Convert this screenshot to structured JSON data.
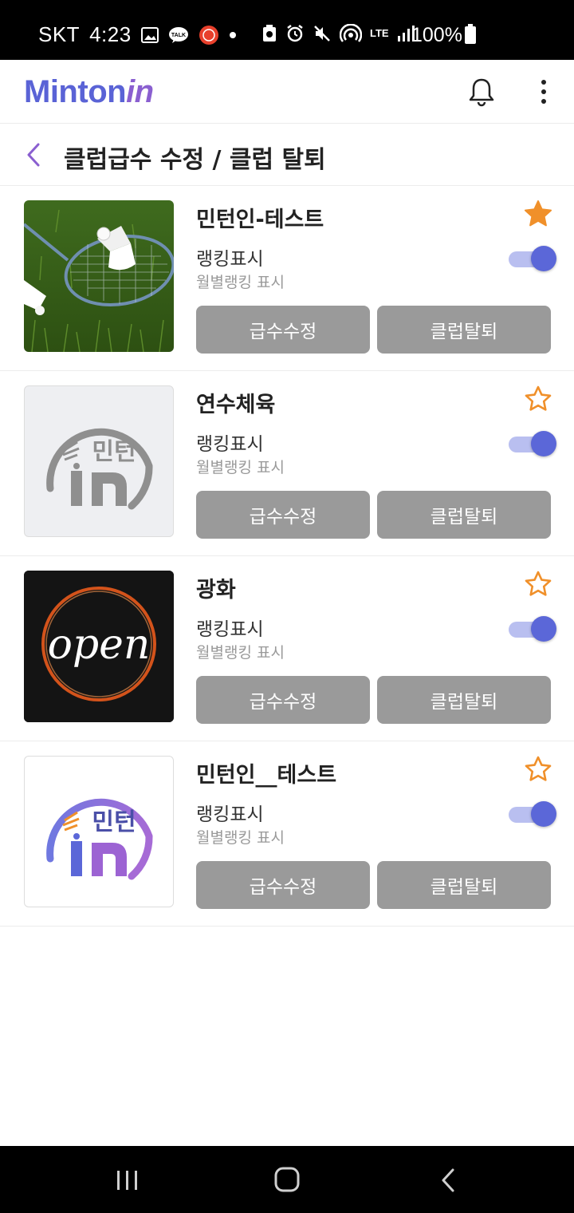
{
  "status_bar": {
    "carrier": "SKT",
    "time": "4:23",
    "battery_percent": "100%",
    "network": "LTE"
  },
  "app_bar": {
    "logo_main": "Minton",
    "logo_accent": "in",
    "brand_color": "#5a63d6"
  },
  "page": {
    "title": "클럽급수 수정 / 클럽 탈퇴"
  },
  "clubs": [
    {
      "name": "민턴인-테스트",
      "favorite": true,
      "rank_label": "랭킹표시",
      "rank_sub": "월별랭킹 표시",
      "rank_enabled": true,
      "grade_button": "급수수정",
      "leave_button": "클럽탈퇴",
      "image": "badminton-racket-shuttlecock"
    },
    {
      "name": "연수체육",
      "favorite": false,
      "rank_label": "랭킹표시",
      "rank_sub": "월별랭킹 표시",
      "rank_enabled": true,
      "grade_button": "급수수정",
      "leave_button": "클럽탈퇴",
      "image": "mintonin-logo-gray",
      "image_text": "민턴"
    },
    {
      "name": "광화",
      "favorite": false,
      "rank_label": "랭킹표시",
      "rank_sub": "월별랭킹 표시",
      "rank_enabled": true,
      "grade_button": "급수수정",
      "leave_button": "클럽탈퇴",
      "image": "neon-open-sign",
      "image_text": "open"
    },
    {
      "name": "민턴인__테스트",
      "favorite": false,
      "rank_label": "랭킹표시",
      "rank_sub": "월별랭킹 표시",
      "rank_enabled": true,
      "grade_button": "급수수정",
      "leave_button": "클럽탈퇴",
      "image": "mintonin-logo-color",
      "image_text": "민턴"
    }
  ],
  "colors": {
    "star": "#f0902a",
    "toggle_on": "#5b67d8",
    "button_bg": "#9a9a9a",
    "back_arrow": "#8a5fd0"
  }
}
